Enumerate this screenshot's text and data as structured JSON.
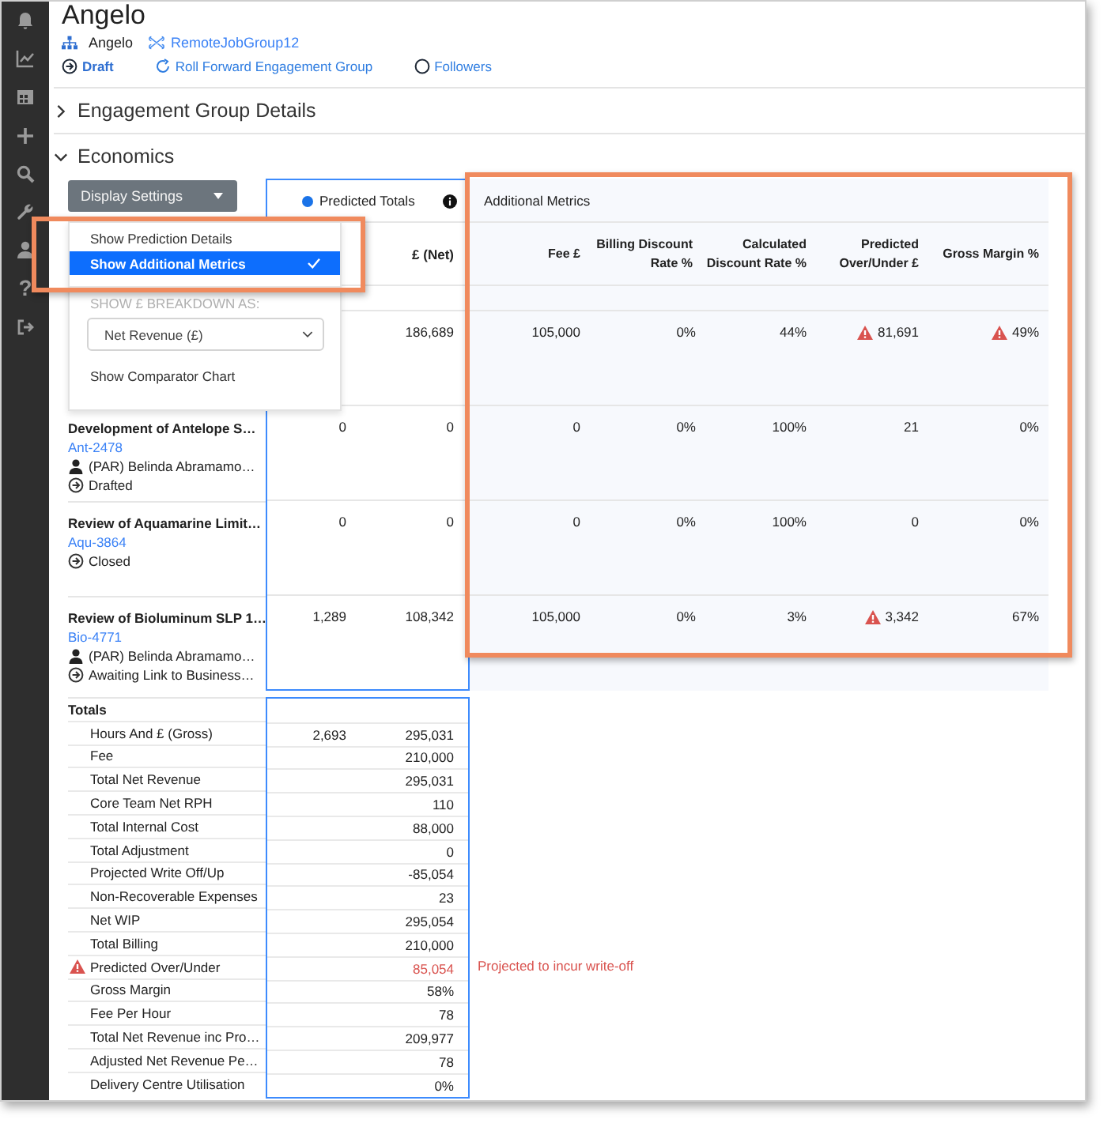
{
  "sidebar": {
    "help_glyph": "?"
  },
  "header": {
    "title": "Angelo",
    "org": "Angelo",
    "group_link": "RemoteJobGroup12",
    "actions": [
      {
        "kind": "status",
        "label": "Draft"
      },
      {
        "kind": "roll",
        "label": "Roll Forward Engagement Group"
      },
      {
        "kind": "followers",
        "label": "Followers"
      }
    ]
  },
  "sections": [
    {
      "title": "Engagement Group Details",
      "expanded": false
    },
    {
      "title": "Economics",
      "expanded": true
    }
  ],
  "display_settings": {
    "button": "Display Settings",
    "menu": [
      {
        "kind": "option",
        "label": "Show Prediction Details",
        "selected": false
      },
      {
        "kind": "option",
        "label": "Show Additional Metrics",
        "selected": true
      },
      {
        "kind": "divider"
      },
      {
        "kind": "heading",
        "label": "SHOW £ BREAKDOWN AS:"
      },
      {
        "kind": "select",
        "value": "Net Revenue (£)"
      },
      {
        "kind": "option",
        "label": "Show Comparator Chart",
        "selected": false
      }
    ]
  },
  "predicted_totals": {
    "title": "Predicted Totals",
    "net_header": "£ (Net)"
  },
  "additional_metrics": {
    "title": "Additional Metrics",
    "columns": [
      "Fee £",
      "Billing Discount Rate %",
      "Calculated Discount Rate %",
      "Predicted Over/Under £",
      "Gross Margin %"
    ]
  },
  "rows": [
    {
      "net": "186,689",
      "metrics": [
        {
          "value": "105,000",
          "warning": false
        },
        {
          "value": "0%",
          "warning": false
        },
        {
          "value": "44%",
          "warning": false
        },
        {
          "value": "81,691",
          "warning": true
        },
        {
          "value": "49%",
          "warning": true
        }
      ]
    },
    {
      "name": "Development of Antelope S…",
      "code": "Ant-2478",
      "owner": "(PAR) Belinda Abramamo…",
      "status": "Drafted",
      "hours": "0",
      "net": "0",
      "metrics": [
        {
          "value": "0",
          "warning": false
        },
        {
          "value": "0%",
          "warning": false
        },
        {
          "value": "100%",
          "warning": false
        },
        {
          "value": "21",
          "warning": false
        },
        {
          "value": "0%",
          "warning": false
        }
      ]
    },
    {
      "name": "Review of Aquamarine Limit…",
      "code": "Aqu-3864",
      "status": "Closed",
      "hours": "0",
      "net": "0",
      "metrics": [
        {
          "value": "0",
          "warning": false
        },
        {
          "value": "0%",
          "warning": false
        },
        {
          "value": "100%",
          "warning": false
        },
        {
          "value": "0",
          "warning": false
        },
        {
          "value": "0%",
          "warning": false
        }
      ]
    },
    {
      "name": "Review of Bioluminum SLP 1…",
      "code": "Bio-4771",
      "owner": "(PAR) Belinda Abramamo…",
      "status": "Awaiting Link to Business…",
      "hours": "1,289",
      "net": "108,342",
      "metrics": [
        {
          "value": "105,000",
          "warning": false
        },
        {
          "value": "0%",
          "warning": false
        },
        {
          "value": "3%",
          "warning": false
        },
        {
          "value": "3,342",
          "warning": true
        },
        {
          "value": "67%",
          "warning": false
        }
      ]
    }
  ],
  "totals": {
    "title": "Totals",
    "rows": [
      {
        "label": "Hours And £ (Gross)",
        "hours": "2,693",
        "value": "295,031",
        "warning": false
      },
      {
        "label": "Fee",
        "value": "210,000",
        "warning": false
      },
      {
        "label": "Total Net Revenue",
        "value": "295,031",
        "warning": false
      },
      {
        "label": "Core Team Net RPH",
        "value": "110",
        "warning": false
      },
      {
        "label": "Total Internal Cost",
        "value": "88,000",
        "warning": false
      },
      {
        "label": "Total Adjustment",
        "value": "0",
        "warning": false
      },
      {
        "label": "Projected Write Off/Up",
        "value": "-85,054",
        "warning": false
      },
      {
        "label": "Non-Recoverable Expenses",
        "value": "23",
        "warning": false
      },
      {
        "label": "Net WIP",
        "value": "295,054",
        "warning": false
      },
      {
        "label": "Total Billing",
        "value": "210,000",
        "warning": false
      },
      {
        "label": "Predicted Over/Under",
        "value": "85,054",
        "warning": true,
        "note": "Projected to incur write-off"
      },
      {
        "label": "Gross Margin",
        "value": "58%",
        "warning": false
      },
      {
        "label": "Fee Per Hour",
        "value": "78",
        "warning": false
      },
      {
        "label": "Total Net Revenue inc Pro…",
        "value": "209,977",
        "warning": false
      },
      {
        "label": "Adjusted Net Revenue Pe…",
        "value": "78",
        "warning": false
      },
      {
        "label": "Delivery Centre Utilisation",
        "value": "0%",
        "warning": false
      }
    ]
  }
}
